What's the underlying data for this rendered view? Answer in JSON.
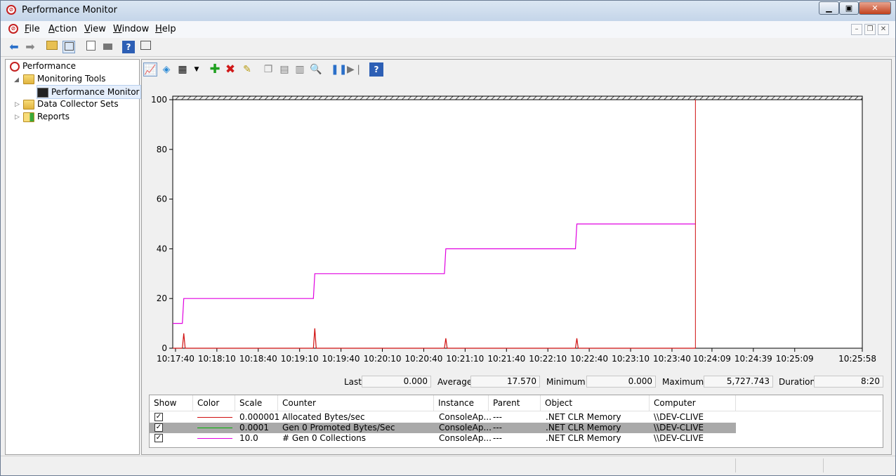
{
  "window": {
    "title": "Performance Monitor"
  },
  "menu": [
    "File",
    "Action",
    "View",
    "Window",
    "Help"
  ],
  "tree": {
    "root": "Performance",
    "monitoring_tools": "Monitoring Tools",
    "performance_monitor": "Performance Monitor",
    "data_collector_sets": "Data Collector Sets",
    "reports": "Reports"
  },
  "stats": {
    "last_label": "Last",
    "last_value": "0.000",
    "average_label": "Average",
    "average_value": "17.570",
    "minimum_label": "Minimum",
    "minimum_value": "0.000",
    "maximum_label": "Maximum",
    "maximum_value": "5,727.743",
    "duration_label": "Duration",
    "duration_value": "8:20"
  },
  "legend": {
    "headers": [
      "Show",
      "Color",
      "Scale",
      "Counter",
      "Instance",
      "Parent",
      "Object",
      "Computer"
    ],
    "rows": [
      {
        "show": true,
        "color": "#d01010",
        "scale": "0.000001",
        "counter": "Allocated Bytes/sec",
        "instance": "ConsoleAp...",
        "parent": "---",
        "object": ".NET CLR Memory",
        "computer": "\\\\DEV-CLIVE"
      },
      {
        "show": true,
        "color": "#00b000",
        "scale": "0.0001",
        "counter": "Gen 0 Promoted Bytes/Sec",
        "instance": "ConsoleAp...",
        "parent": "---",
        "object": ".NET CLR Memory",
        "computer": "\\\\DEV-CLIVE"
      },
      {
        "show": true,
        "color": "#e000e0",
        "scale": "10.0",
        "counter": "# Gen 0 Collections",
        "instance": "ConsoleAp...",
        "parent": "---",
        "object": ".NET CLR Memory",
        "computer": "\\\\DEV-CLIVE"
      }
    ]
  },
  "chart_data": {
    "type": "line",
    "ylim": [
      0,
      100
    ],
    "y_ticks": [
      0,
      20,
      40,
      60,
      80,
      100
    ],
    "x_ticks": [
      "10:17:40",
      "10:18:10",
      "10:18:40",
      "10:19:10",
      "10:19:40",
      "10:20:10",
      "10:20:40",
      "10:21:10",
      "10:21:40",
      "10:22:10",
      "10:22:40",
      "10:23:10",
      "10:23:40",
      "10:24:09",
      "10:24:39",
      "10:25:09",
      "10:25:58"
    ],
    "time_range": [
      "10:17:38",
      "10:25:58"
    ],
    "current_time": "10:23:57",
    "grid": false,
    "series": [
      {
        "color": "#e000e0",
        "points": [
          [
            "10:17:38",
            10
          ],
          [
            "10:17:45",
            10
          ],
          [
            "10:17:46",
            20
          ],
          [
            "10:19:20",
            20
          ],
          [
            "10:19:21",
            30
          ],
          [
            "10:20:55",
            30
          ],
          [
            "10:20:56",
            40
          ],
          [
            "10:22:30",
            40
          ],
          [
            "10:22:31",
            50
          ],
          [
            "10:23:57",
            50
          ]
        ]
      },
      {
        "color": "#d01010",
        "points": [
          [
            "10:17:38",
            0
          ],
          [
            "10:17:45",
            0
          ],
          [
            "10:17:46",
            6
          ],
          [
            "10:17:47",
            0
          ],
          [
            "10:19:20",
            0
          ],
          [
            "10:19:21",
            8
          ],
          [
            "10:19:22",
            0
          ],
          [
            "10:20:55",
            0
          ],
          [
            "10:20:56",
            4
          ],
          [
            "10:20:57",
            0
          ],
          [
            "10:22:30",
            0
          ],
          [
            "10:22:31",
            4
          ],
          [
            "10:22:32",
            0
          ],
          [
            "10:23:57",
            0
          ]
        ]
      }
    ]
  }
}
